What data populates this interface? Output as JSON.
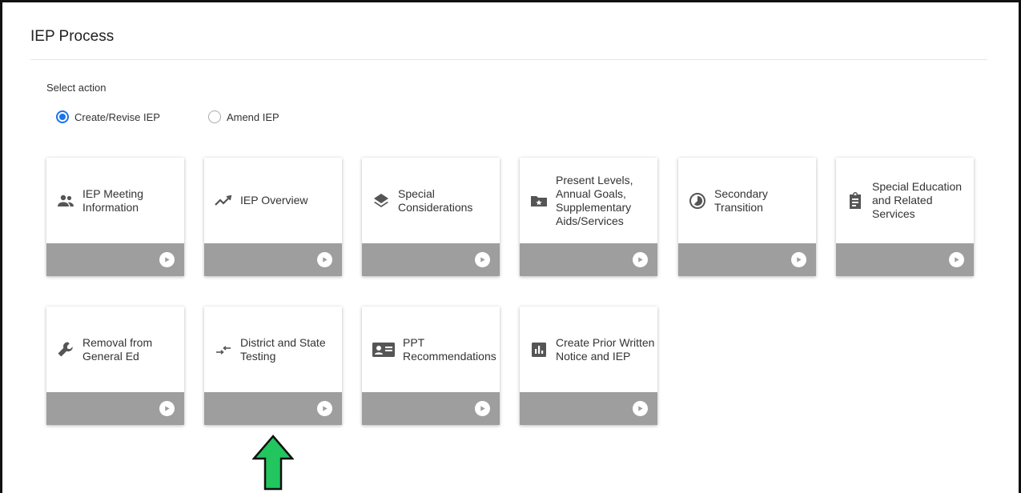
{
  "page": {
    "title": "IEP Process"
  },
  "action": {
    "label": "Select action",
    "options": [
      {
        "label": "Create/Revise IEP",
        "selected": true
      },
      {
        "label": "Amend IEP",
        "selected": false
      }
    ]
  },
  "tiles": [
    {
      "label": "IEP Meeting Information",
      "icon": "people-icon"
    },
    {
      "label": "IEP Overview",
      "icon": "trend-line-icon"
    },
    {
      "label": "Special Considerations",
      "icon": "layers-icon"
    },
    {
      "label": "Present Levels, Annual Goals, Supplementary Aids/Services",
      "icon": "folder-star-icon"
    },
    {
      "label": "Secondary Transition",
      "icon": "timelapse-icon"
    },
    {
      "label": "Special Education and Related Services",
      "icon": "clipboard-icon"
    },
    {
      "label": "Removal from General Ed",
      "icon": "wrench-icon"
    },
    {
      "label": "District and State Testing",
      "icon": "swap-arrows-icon"
    },
    {
      "label": "PPT Recommendations",
      "icon": "id-card-icon"
    },
    {
      "label": "Create Prior Written Notice and IEP",
      "icon": "bar-chart-icon"
    }
  ],
  "colors": {
    "accent": "#1a73e8",
    "tile_footer": "#9e9e9e",
    "pointer_arrow": "#22c55e"
  }
}
